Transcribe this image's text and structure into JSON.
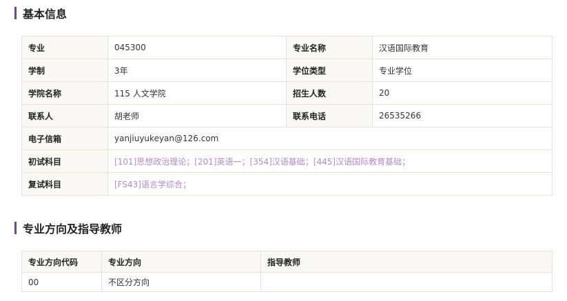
{
  "basic_info": {
    "title": "基本信息",
    "rows": {
      "major_code_label": "专业",
      "major_code": "045300",
      "major_name_label": "专业名称",
      "major_name": "汉语国际教育",
      "duration_label": "学制",
      "duration": "3年",
      "degree_type_label": "学位类型",
      "degree_type": "专业学位",
      "college_label": "学院名称",
      "college": "115 人文学院",
      "enrollment_label": "招生人数",
      "enrollment": "20",
      "contact_label": "联系人",
      "contact": "胡老师",
      "phone_label": "联系电话",
      "phone": "26535266",
      "email_label": "电子信箱",
      "email": "yanjiuyukeyan@126.com",
      "prelim_label": "初试科目",
      "prelim_subjects": "[101]思想政治理论；[201]英语一；[354]汉语基础；[445]汉语国际教育基础；",
      "retest_label": "复试科目",
      "retest_subjects": "[FS43]语言学综合；"
    }
  },
  "directions": {
    "title": "专业方向及指导教师",
    "headers": [
      "专业方向代码",
      "专业方向",
      "指导教师"
    ],
    "rows": [
      {
        "code": "00",
        "direction": "不区分方向",
        "advisor": ""
      }
    ]
  },
  "colors": {
    "accent": "#7b3fa0",
    "link": "#b08cc9",
    "label_bg": "#faf8f5",
    "border": "#e6e1d9"
  }
}
